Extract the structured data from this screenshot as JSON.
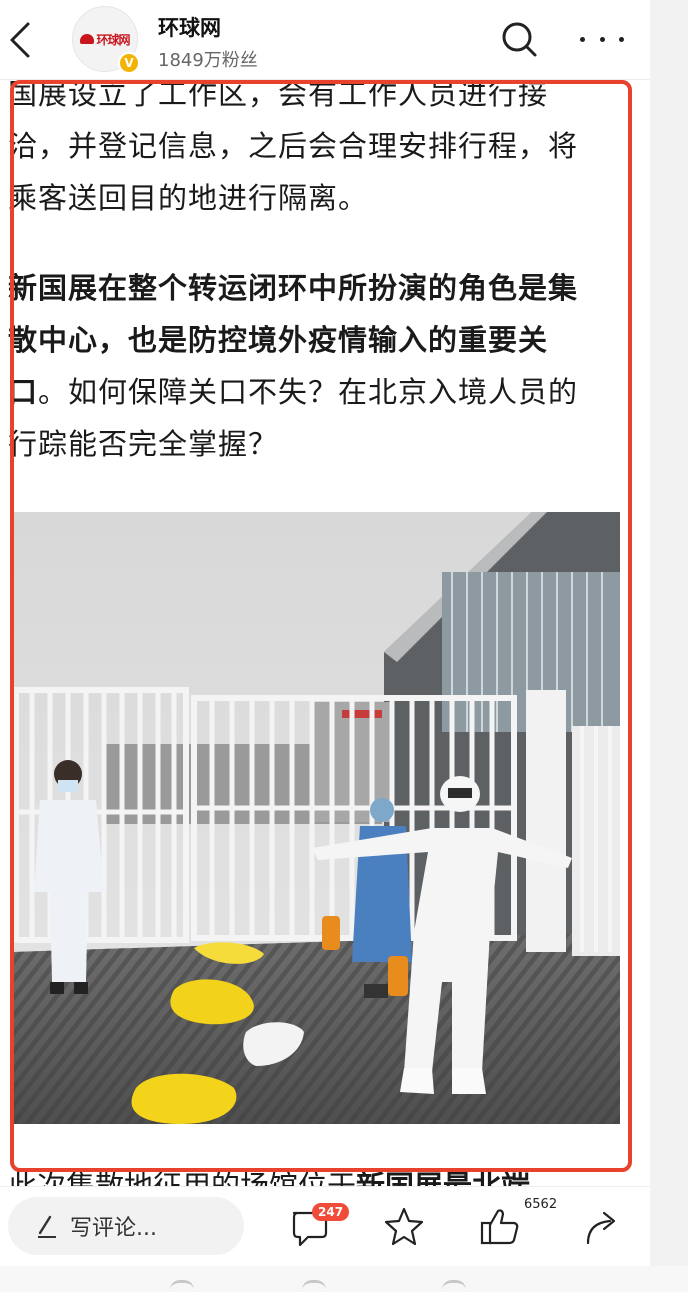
{
  "header": {
    "back_label": "back",
    "account_name": "环球网",
    "fans": "1849万粉丝",
    "logo_text": "环球网",
    "verified_mark": "V"
  },
  "article": {
    "para1_lines": [
      "国展设立了工作区，会有工作人员进行接",
      "洽，并登记信息，之后会合理安排行程，将",
      "乘客送回目的地进行隔离。"
    ],
    "para2_bold_lines": [
      "新国展在整个转运闭环中所扮演的角色是集",
      "散中心，也是防控境外疫情输入的重要关"
    ],
    "para2_mixed_bold": "口",
    "para2_mixed_rest": "。如何保障关口不失？在北京入境人员的",
    "para2_last": "行踪能否完全掌握？",
    "cutoff_normal": "此次集散地征用的场馆位于",
    "cutoff_bold": "新国展最北端"
  },
  "photo": {
    "description_icon": "photo-image"
  },
  "bottom_bar": {
    "comment_placeholder": "写评论...",
    "comment_count": "247",
    "like_count": "6562"
  },
  "colors": {
    "highlight": "#e8412c",
    "badge": "#f14b3a",
    "brand_red": "#c8161d"
  }
}
